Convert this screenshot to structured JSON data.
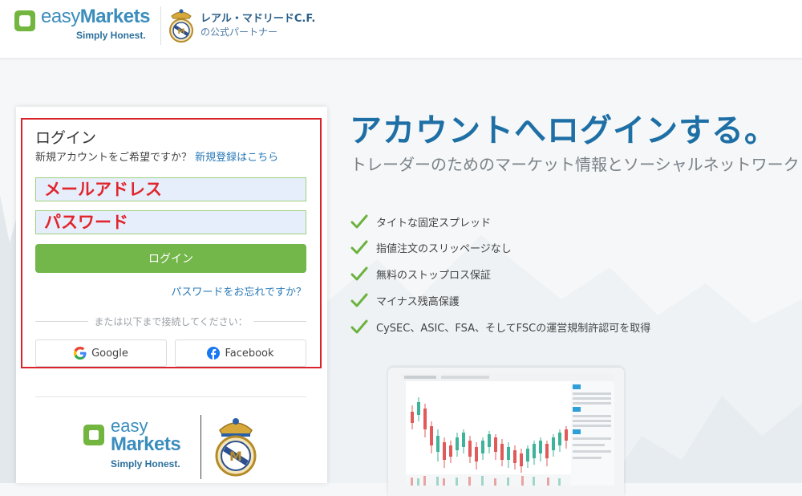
{
  "header": {
    "logo": {
      "word_part1": "easy",
      "word_part2": "Markets",
      "tagline": "Simply Honest."
    },
    "partner": {
      "line1": "レアル・マドリードC.F.",
      "line2": "の公式パートナー"
    }
  },
  "login": {
    "title": "ログイン",
    "signup_prompt": "新規アカウントをご希望ですか？",
    "signup_link": "新規登録はこちら",
    "email_placeholder": "メールアドレス",
    "password_placeholder": "パスワード",
    "login_button": "ログイン",
    "forgot_password": "パスワードをお忘れですか？",
    "or_connect": "または以下まで接続してください：",
    "google_button": "Google",
    "facebook_button": "Facebook"
  },
  "card_logo": {
    "word_part1": "easy",
    "word_part2": "Markets",
    "tagline": "Simply Honest."
  },
  "hero": {
    "title": "アカウントへログインする。",
    "subtitle": "トレーダーのためのマーケット情報とソーシャルネットワーク"
  },
  "features": [
    "タイトな固定スプレッド",
    "指値注文のスリッページなし",
    "無料のストップロス保証",
    "マイナス残高保護",
    "CySEC、ASIC、FSA、そしてFSCの運営規制許認可を取得"
  ],
  "colors": {
    "brand_blue": "#1d6fa5",
    "brand_green": "#73b64a",
    "highlight_red": "#d9242c",
    "link_blue": "#2a7ab8"
  },
  "icons": {
    "check": "check-icon",
    "google": "google-icon",
    "facebook": "facebook-icon",
    "crest": "real-madrid-crest-icon"
  }
}
